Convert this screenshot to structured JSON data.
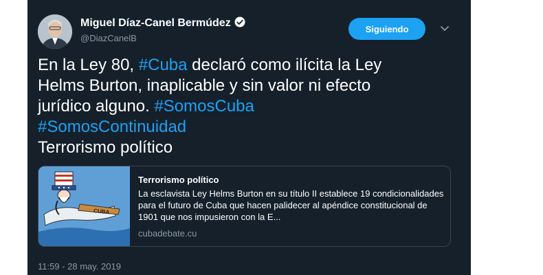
{
  "author": {
    "display_name": "Miguel Díaz-Canel Bermúdez",
    "handle": "@DiazCanelB",
    "verified": true
  },
  "follow_button": {
    "label": "Siguiendo"
  },
  "tweet": {
    "lines": [
      [
        {
          "text": "En la Ley 80, ",
          "hashtag": false
        },
        {
          "text": "#Cuba",
          "hashtag": true
        },
        {
          "text": " declaró como ilícita la Ley",
          "hashtag": false
        }
      ],
      [
        {
          "text": "Helms Burton, inaplicable y sin valor ni efecto",
          "hashtag": false
        }
      ],
      [
        {
          "text": "jurídico alguno. ",
          "hashtag": false
        },
        {
          "text": "#SomosCuba",
          "hashtag": true
        }
      ],
      [
        {
          "text": "#SomosContinuidad",
          "hashtag": true
        }
      ],
      [
        {
          "text": "Terrorismo político",
          "hashtag": false
        }
      ]
    ]
  },
  "card": {
    "title": "Terrorismo político",
    "description": "La esclavista Ley Helms Burton en su título II establece 19 condicionalidades para el futuro de Cuba que hacen palidecer al apéndice constitucional de 1901 que nos impusieron con la E...",
    "domain": "cubadebate.cu",
    "image_label": "CUBA"
  },
  "timestamp": "11:59 - 28 may. 2019",
  "colors": {
    "background": "#15202b",
    "accent": "#1da1f2",
    "secondary_text": "#8899a6",
    "border": "#38444d"
  }
}
